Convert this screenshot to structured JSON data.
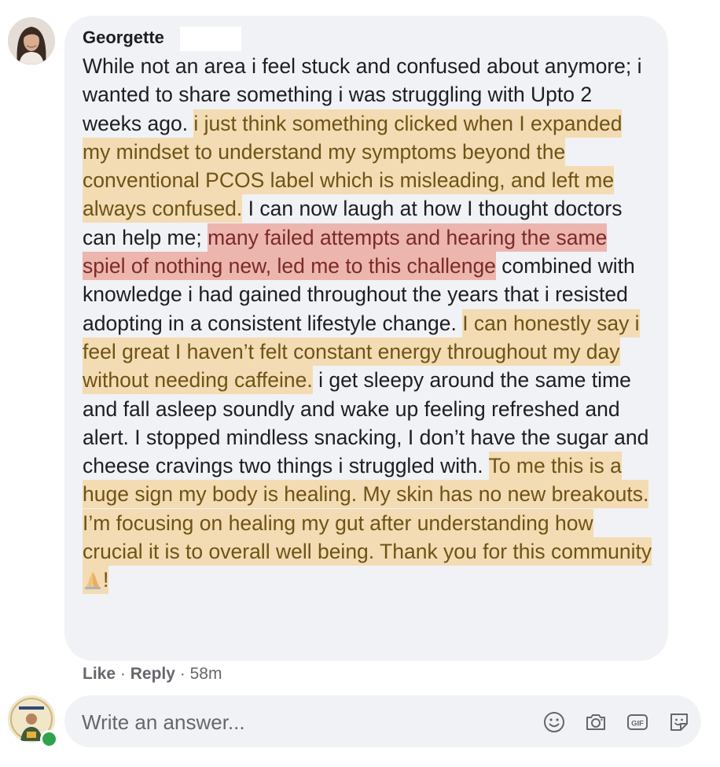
{
  "comment": {
    "author": "Georgette",
    "segments": [
      {
        "text": "While not an area i feel stuck and confused about anymore; i wanted to share something i was struggling with Upto 2 weeks ago. ",
        "highlight": "none"
      },
      {
        "text": "i just think something clicked when I expanded my mindset to understand my symptoms beyond the conventional PCOS label which is misleading, and left me always confused.",
        "highlight": "yellow"
      },
      {
        "text": " I can now laugh at how I thought doctors can help me; ",
        "highlight": "none"
      },
      {
        "text": "many failed attempts and hearing the same spiel of nothing new, led me to this challenge",
        "highlight": "red"
      },
      {
        "text": " combined with knowledge i had gained throughout the years that i resisted adopting in a consistent lifestyle change. ",
        "highlight": "none"
      },
      {
        "text": "I can honestly say i feel great I haven’t felt constant energy throughout my day without needing caffeine.",
        "highlight": "yellow"
      },
      {
        "text": " i get sleepy around the same time and fall asleep soundly and wake up feeling refreshed and alert. I stopped mindless snacking, I don’t have the sugar and cheese cravings two things i struggled with. ",
        "highlight": "none"
      },
      {
        "text": "To me this is a huge sign my body is healing. My skin has no new breakouts. I’m focusing on healing my gut after understanding how crucial it is to overall well being. Thank you for this community ",
        "highlight": "yellow"
      },
      {
        "text": "!",
        "highlight": "yellow"
      }
    ],
    "emoji_icon": "folded-hands-emoji",
    "actions": {
      "like": "Like",
      "separator": "·",
      "reply": "Reply",
      "time": "58m"
    }
  },
  "reply_box": {
    "placeholder": "Write an answer...",
    "icons": [
      "emoji-icon",
      "camera-icon",
      "gif-icon",
      "sticker-icon"
    ]
  },
  "colors": {
    "bubble": "#f0f2f5",
    "highlight_yellow": "#f3dcb3",
    "highlight_red": "#ecb6af",
    "online": "#31a24c",
    "muted_text": "#65676b"
  }
}
